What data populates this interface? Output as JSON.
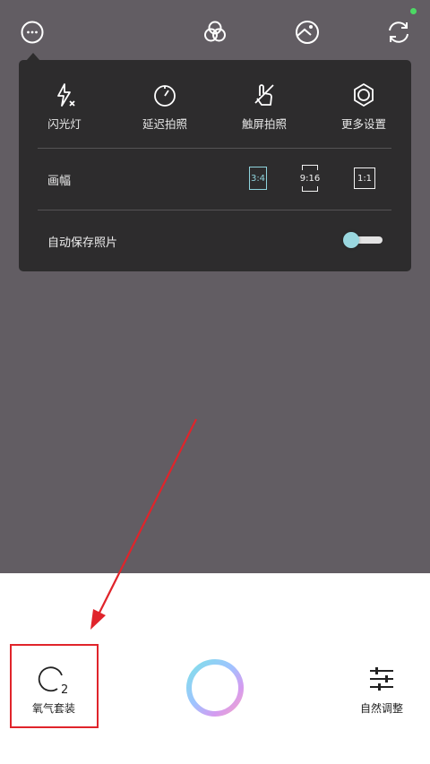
{
  "top_bar": {
    "icons": [
      "more-icon",
      "filter-icon",
      "adjust-icon",
      "switch-camera-icon"
    ],
    "status_dot_color": "#4cd964"
  },
  "settings_panel": {
    "options": [
      {
        "label": "闪光灯",
        "icon": "flash-off-icon"
      },
      {
        "label": "延迟拍照",
        "icon": "timer-icon"
      },
      {
        "label": "触屏拍照",
        "icon": "touch-shoot-icon"
      },
      {
        "label": "更多设置",
        "icon": "settings-icon"
      }
    ],
    "aspect": {
      "label": "画幅",
      "options": [
        "3:4",
        "9:16",
        "1:1"
      ],
      "selected": "3:4",
      "accent": "#8fd3dc"
    },
    "autosave": {
      "label": "自动保存照片",
      "enabled": false
    }
  },
  "bottom_bar": {
    "left_button": {
      "label": "氧气套装",
      "icon": "oxygen-icon"
    },
    "shutter": {
      "icon": "shutter-ring-icon"
    },
    "right_button": {
      "label": "自然调整",
      "icon": "sliders-icon"
    }
  },
  "annotation": {
    "color": "#e0242b"
  }
}
